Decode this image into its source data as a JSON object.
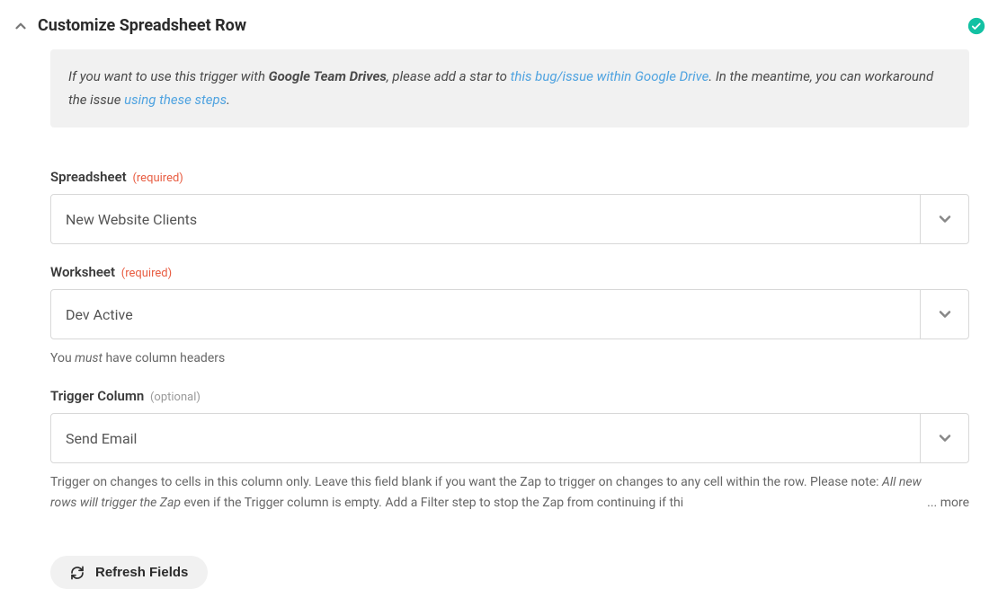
{
  "header": {
    "title": "Customize Spreadsheet Row"
  },
  "callout": {
    "text1": "If you want to use this trigger with ",
    "bold": "Google Team Drives",
    "text2": ", please add a star to ",
    "link1": "this bug/issue within Google Drive",
    "text3": ". In the meantime, you can workaround the issue ",
    "link2": "using these steps",
    "text4": "."
  },
  "fields": {
    "spreadsheet": {
      "label": "Spreadsheet",
      "tag": "(required)",
      "value": "New Website Clients"
    },
    "worksheet": {
      "label": "Worksheet",
      "tag": "(required)",
      "value": "Dev Active",
      "help_pre": "You ",
      "help_em": "must",
      "help_post": " have column headers"
    },
    "trigger_column": {
      "label": "Trigger Column",
      "tag": "(optional)",
      "value": "Send Email",
      "help_pre": "Trigger on changes to cells in this column only. Leave this field blank if you want the Zap to trigger on changes to any cell within the row. Please note: ",
      "help_em": "All new rows will trigger the Zap",
      "help_post": " even if the Trigger column is empty. Add a Filter step to stop the Zap from continuing if thi",
      "more": "...   more"
    }
  },
  "buttons": {
    "refresh": "Refresh Fields"
  }
}
